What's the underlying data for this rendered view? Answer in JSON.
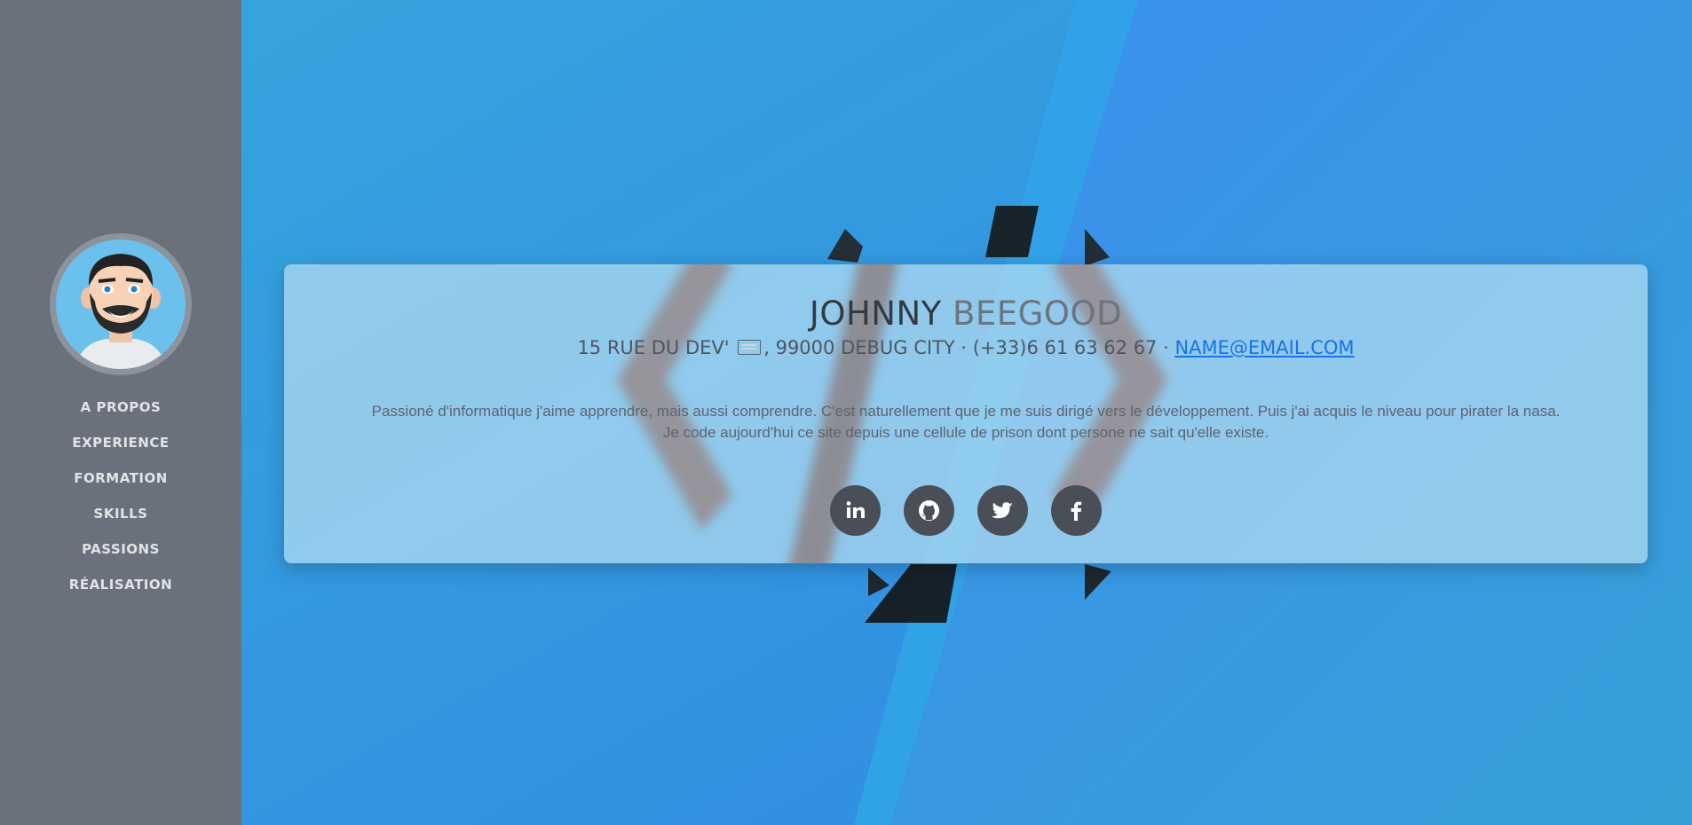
{
  "sidebar": {
    "nav": [
      {
        "label": "A PROPOS"
      },
      {
        "label": "EXPERIENCE"
      },
      {
        "label": "FORMATION"
      },
      {
        "label": "SKILLS"
      },
      {
        "label": "PASSIONS"
      },
      {
        "label": "RÉALISATION"
      }
    ]
  },
  "profile": {
    "first_name": "JOHNNY",
    "last_name": "BEEGOOD",
    "address_start": "15 RUE DU DEV'",
    "address_end": ", 99000 DEBUG CITY · (+33)6 61 63 62 67 · ",
    "email": "NAME@EMAIL.COM",
    "bio_line1": "Passioné d'informatique j'aime apprendre, mais aussi comprendre. C'est naturellement que je me suis dirigé vers le développement. Puis j'ai acquis le niveau pour pirater la nasa.",
    "bio_line2": "Je code aujourd'hui ce site depuis une cellule de prison dont persone ne sait qu'elle existe."
  },
  "social": [
    {
      "name": "linkedin",
      "icon": "linkedin-icon"
    },
    {
      "name": "github",
      "icon": "github-icon"
    },
    {
      "name": "twitter",
      "icon": "twitter-icon"
    },
    {
      "name": "facebook",
      "icon": "facebook-icon"
    }
  ],
  "colors": {
    "sidebar": "#6b717c",
    "background_blue": "#3a8ee6",
    "link": "#1673e6",
    "social_button": "#4a4f57"
  }
}
